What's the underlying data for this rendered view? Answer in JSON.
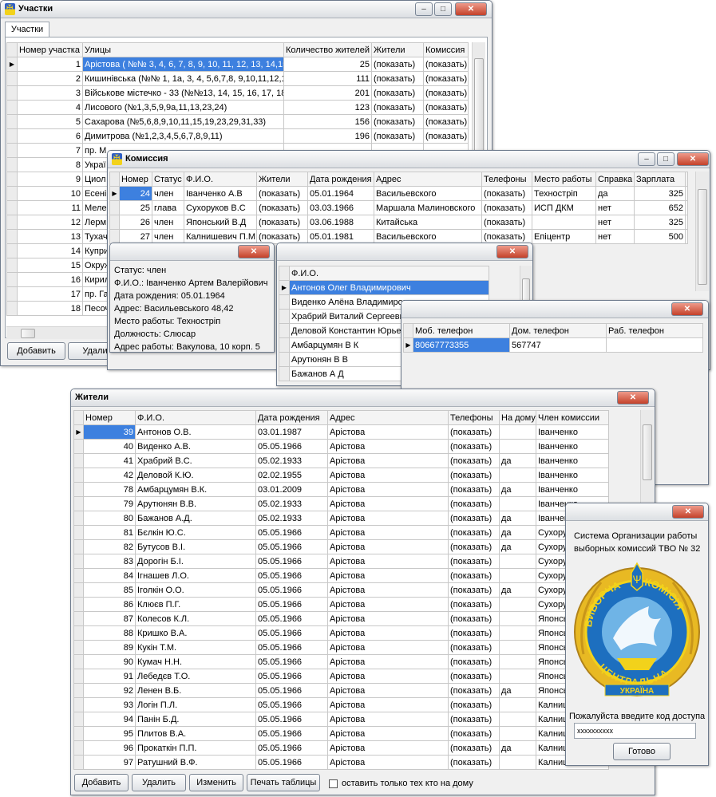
{
  "w1": {
    "title": "Участки",
    "tab": "Участки",
    "cols": [
      "Номер участка",
      "Улицы",
      "Количество жителей",
      "Жители",
      "Комиссия"
    ],
    "rows": [
      [
        "1",
        "Арістова ( №№ 3, 4, 6, 7, 8, 9, 10, 11, 12, 13, 14,15",
        "25",
        "(показать)",
        "(показать)"
      ],
      [
        "2",
        "Кишинівська (№№ 1, 1а, 3, 4, 5,6,7,8, 9,10,11,12,1",
        "111",
        "(показать)",
        "(показать)"
      ],
      [
        "3",
        "Військове містечко - 33 (№№13, 14, 15, 16, 17, 18",
        "201",
        "(показать)",
        "(показать)"
      ],
      [
        "4",
        "Лисового (№1,3,5,9,9а,11,13,23,24)",
        "123",
        "(показать)",
        "(показать)"
      ],
      [
        "5",
        "Сахарова (№5,6,8,9,10,11,15,19,23,29,31,33)",
        "156",
        "(показать)",
        "(показать)"
      ],
      [
        "6",
        "Димитрова (№1,2,3,4,5,6,7,8,9,11)",
        "196",
        "(показать)",
        "(показать)"
      ],
      [
        "7",
        "пр. М",
        "",
        "",
        ""
      ],
      [
        "8",
        "Украї",
        "",
        "",
        ""
      ],
      [
        "9",
        "Циол",
        "",
        "",
        ""
      ],
      [
        "10",
        "Есені",
        "",
        "",
        ""
      ],
      [
        "11",
        "Меле",
        "",
        "",
        ""
      ],
      [
        "12",
        "Лерм",
        "",
        "",
        ""
      ],
      [
        "13",
        "Тухач",
        "",
        "",
        ""
      ],
      [
        "14",
        "Купри",
        "",
        "",
        ""
      ],
      [
        "15",
        "Окруж",
        "",
        "",
        ""
      ],
      [
        "16",
        "Кирил",
        "",
        "",
        ""
      ],
      [
        "17",
        "пр. Га",
        "",
        "",
        ""
      ],
      [
        "18",
        "Песоч",
        "",
        "",
        ""
      ]
    ],
    "add": "Добавить",
    "del": "Удалит"
  },
  "w2": {
    "title": "Комиссия",
    "cols": [
      "Номер",
      "Статус",
      "Ф.И.О.",
      "Жители",
      "Дата рождения",
      "Адрес",
      "Телефоны",
      "Место работы",
      "Справка",
      "Зарплата"
    ],
    "rows": [
      [
        "24",
        "член",
        "Іванченко А.В",
        "(показать)",
        "05.01.1964",
        "Васильевского",
        "(показать)",
        "Техностріп",
        "да",
        "325"
      ],
      [
        "25",
        "глава",
        "Сухоруков В.С",
        "(показать)",
        "03.03.1966",
        "Маршала Малиновского",
        "(показать)",
        "ИСП ДКМ",
        "нет",
        "652"
      ],
      [
        "26",
        "член",
        "Японський В.Д",
        "(показать)",
        "03.06.1988",
        "Китайська",
        "(показать)",
        "",
        "нет",
        "325"
      ],
      [
        "27",
        "член",
        "Калнишевич П.М",
        "(показать)",
        "05.01.1981",
        "Васильевского",
        "(показать)",
        "Епіцентр",
        "нет",
        "500"
      ]
    ]
  },
  "w3": {
    "lines": [
      "Статус:  член",
      "Ф.И.О.:  Іванченко Артем Валерійович",
      "Дата рождения:  05.01.1964",
      "Адрес:  Васильевського 48,42",
      "Место работы:  Техностріп",
      "Должность:  Слюсар",
      "Адрес работы:  Вакулова, 10 корп. 5"
    ]
  },
  "w4": {
    "col": "Ф.И.О.",
    "rows": [
      "Антонов Олег Владимирович",
      "Виденко Алёна Владимировна",
      "Храбрий Виталий Сергеевич",
      "Деловой Константин Юрьевич",
      "Амбарцумян  В К",
      "Арутюнян В В",
      "Бажанов А Д"
    ]
  },
  "w5": {
    "cols": [
      "Моб. телефон",
      "Дом. телефон",
      "Раб. телефон"
    ],
    "row": [
      "80667773355",
      "567747",
      ""
    ]
  },
  "w6": {
    "title": "Жители",
    "cols": [
      "Номер",
      "Ф.И.О.",
      "Дата рождения",
      "Адрес",
      "Телефоны",
      "На дому",
      "Член комиссии"
    ],
    "rows": [
      [
        "39",
        "Антонов О.В.",
        "03.01.1987",
        "Арістова",
        "(показать)",
        "",
        "Іванченко"
      ],
      [
        "40",
        "Виденко А.В.",
        "05.05.1966",
        "Арістова",
        "(показать)",
        "",
        "Іванченко"
      ],
      [
        "41",
        "Храбрий В.С.",
        "05.02.1933",
        "Арістова",
        "(показать)",
        "да",
        "Іванченко"
      ],
      [
        "42",
        "Деловой К.Ю.",
        "02.02.1955",
        "Арістова",
        "(показать)",
        "",
        "Іванченко"
      ],
      [
        "78",
        "Амбарцумян  В.К.",
        "03.01.2009",
        "Арістова",
        "(показать)",
        "да",
        "Іванченко"
      ],
      [
        "79",
        "Арутюнян В.В.",
        "05.02.1933",
        "Арістова",
        "(показать)",
        "",
        "Іванченко"
      ],
      [
        "80",
        "Бажанов А.Д.",
        "05.02.1933",
        "Арістова",
        "(показать)",
        "да",
        "Іванченко"
      ],
      [
        "81",
        "Бєлкін Ю.С.",
        "05.05.1966",
        "Арістова",
        "(показать)",
        "да",
        "Сухоруков"
      ],
      [
        "82",
        "Бутусов В.І.",
        "05.05.1966",
        "Арістова",
        "(показать)",
        "да",
        "Сухоруков"
      ],
      [
        "83",
        "Дорогін Б.І.",
        "05.05.1966",
        "Арістова",
        "(показать)",
        "",
        "Сухоруков"
      ],
      [
        "84",
        "Ігнашев Л.О.",
        "05.05.1966",
        "Арістова",
        "(показать)",
        "",
        "Сухоруков"
      ],
      [
        "85",
        "Іголкін О.О.",
        "05.05.1966",
        "Арістова",
        "(показать)",
        "да",
        "Сухоруков"
      ],
      [
        "86",
        "Клюєв П.Г.",
        "05.05.1966",
        "Арістова",
        "(показать)",
        "",
        "Сухоруков"
      ],
      [
        "87",
        "Колесов К.Л.",
        "05.05.1966",
        "Арістова",
        "(показать)",
        "",
        "Японський"
      ],
      [
        "88",
        "Кришко В.А.",
        "05.05.1966",
        "Арістова",
        "(показать)",
        "",
        "Японський"
      ],
      [
        "89",
        "Кукін Т.М.",
        "05.05.1966",
        "Арістова",
        "(показать)",
        "",
        "Японський"
      ],
      [
        "90",
        "Кумач Н.Н.",
        "05.05.1966",
        "Арістова",
        "(показать)",
        "",
        "Японський"
      ],
      [
        "91",
        "Лебедєв Т.О.",
        "05.05.1966",
        "Арістова",
        "(показать)",
        "",
        "Японський"
      ],
      [
        "92",
        "Ленен В.Б.",
        "05.05.1966",
        "Арістова",
        "(показать)",
        "да",
        "Японський"
      ],
      [
        "93",
        "Логін П.Л.",
        "05.05.1966",
        "Арістова",
        "(показать)",
        "",
        "Калнишевич"
      ],
      [
        "94",
        "Панін Б.Д.",
        "05.05.1966",
        "Арістова",
        "(показать)",
        "",
        "Калнишевич"
      ],
      [
        "95",
        "Плитов В.А.",
        "05.05.1966",
        "Арістова",
        "(показать)",
        "",
        "Калнишевич"
      ],
      [
        "96",
        "Прокаткін П.П.",
        "05.05.1966",
        "Арістова",
        "(показать)",
        "да",
        "Калнишевич"
      ],
      [
        "97",
        "Ратушний В.Ф.",
        "05.05.1966",
        "Арістова",
        "(показать)",
        "",
        "Калнишевич"
      ]
    ],
    "buttons": [
      "Добавить",
      "Удалить",
      "Изменить",
      "Печать таблицы"
    ],
    "checkbox": "оставить только тех кто на дому"
  },
  "w7": {
    "heading": [
      "Система Организации работы",
      "выборных комиссий ТВО № 32"
    ],
    "emblem_top": "ВИБОРЧА",
    "emblem_right": "КОМІСІЯ",
    "emblem_bottom": "ЦЕНТРАЛЬНА",
    "emblem_country": "УКРАЇНА",
    "prompt": "Пожалуйста введите код доступа",
    "password": "xxxxxxxxxx",
    "ok": "Готово"
  },
  "colors": {
    "selection": "#3d80df",
    "emblem_gold": "#e8b923",
    "emblem_blue": "#1d6fbf"
  }
}
